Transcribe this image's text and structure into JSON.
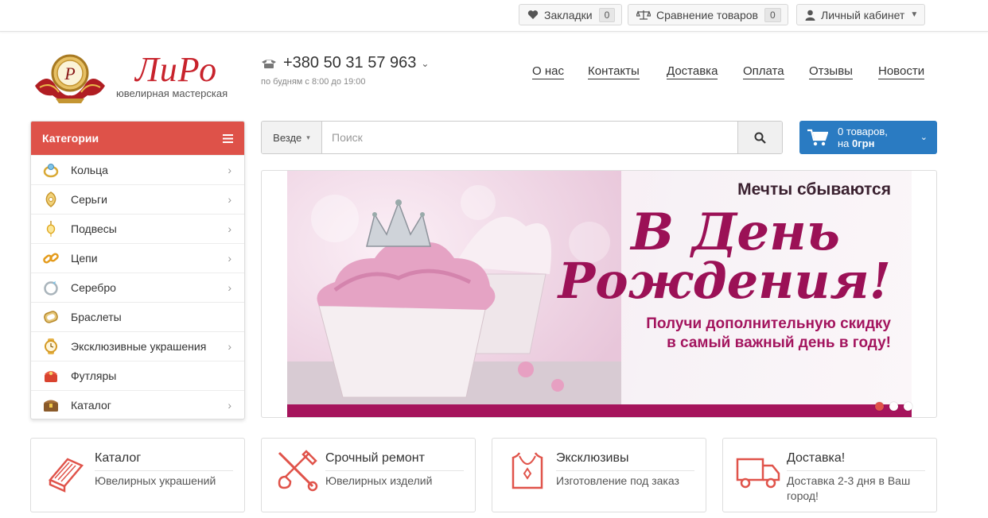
{
  "topbar": {
    "bookmarks": {
      "label": "Закладки",
      "count": "0",
      "icon": "heart-icon"
    },
    "compare": {
      "label": "Сравнение товаров",
      "count": "0",
      "icon": "scales-icon"
    },
    "account": {
      "label": "Личный кабинет",
      "icon": "user-icon"
    }
  },
  "header": {
    "logo_text": "ЛиРо",
    "logo_sub": "ювелирная мастерская",
    "phone": "+380 50 31 57 963",
    "hours": "по будням с 8:00 до 19:00",
    "nav": [
      "О нас",
      "Контакты",
      "Доставка",
      "Оплата",
      "Отзывы",
      "Новости"
    ]
  },
  "categories": {
    "title": "Категории",
    "items": [
      {
        "label": "Кольца",
        "icon": "ring-icon",
        "has_sub": true
      },
      {
        "label": "Серьги",
        "icon": "earrings-icon",
        "has_sub": true
      },
      {
        "label": "Подвесы",
        "icon": "pendant-icon",
        "has_sub": true
      },
      {
        "label": "Цепи",
        "icon": "chain-icon",
        "has_sub": true
      },
      {
        "label": "Серебро",
        "icon": "silver-icon",
        "has_sub": true
      },
      {
        "label": "Браслеты",
        "icon": "bracelet-icon",
        "has_sub": false
      },
      {
        "label": "Эксклюзивные украшения",
        "icon": "watch-icon",
        "has_sub": true
      },
      {
        "label": "Футляры",
        "icon": "jewelry-box-icon",
        "has_sub": false
      },
      {
        "label": "Каталог",
        "icon": "chest-icon",
        "has_sub": true
      }
    ]
  },
  "search": {
    "scope": "Везде",
    "placeholder": "Поиск",
    "value": ""
  },
  "cart": {
    "line1": "0 товаров,",
    "line2_prefix": "на ",
    "line2_amount": "0грн"
  },
  "banner": {
    "small": "Мечты сбываются",
    "big1": "В День",
    "big2": "Рождения!",
    "sub1": "Получи дополнительную скидку",
    "sub2": "в самый важный день в году!",
    "slides": 3,
    "active_slide": 1
  },
  "features": [
    {
      "title": "Каталог",
      "sub": "Ювелирных украшений",
      "icon": "book-icon"
    },
    {
      "title": "Срочный ремонт",
      "sub": "Ювелирных изделий",
      "icon": "tools-icon"
    },
    {
      "title": "Эксклюзивы",
      "sub": "Изготовление под заказ",
      "icon": "necklace-icon"
    },
    {
      "title": "Доставка!",
      "sub": "Доставка 2-3 дня в Ваш город!",
      "icon": "truck-icon"
    }
  ],
  "colors": {
    "accent_red": "#de5249",
    "cart_blue": "#2a7bc2",
    "banner_magenta": "#9b1156"
  }
}
